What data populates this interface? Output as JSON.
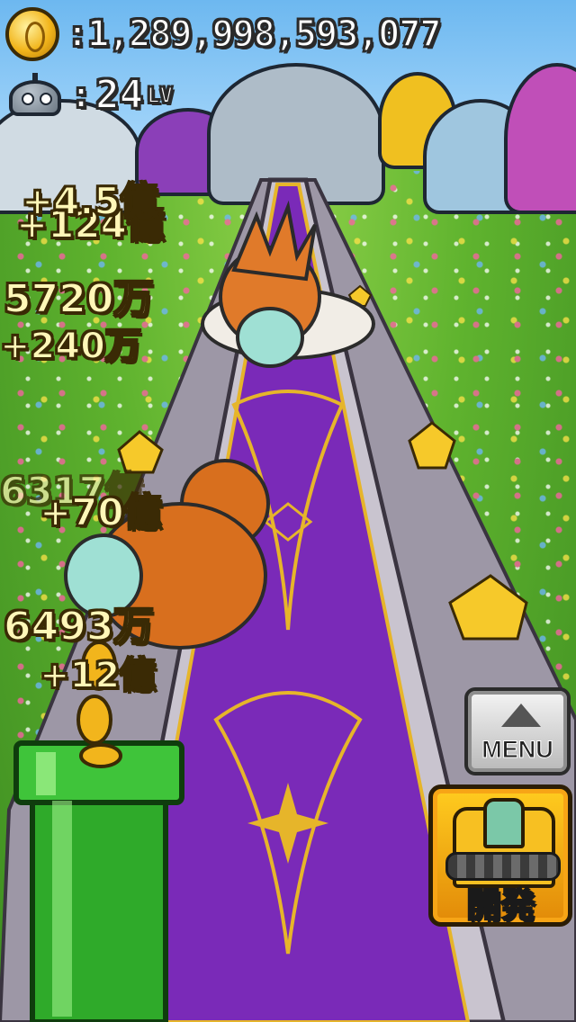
{
  "hud": {
    "coins": ":1,289,998,593,077",
    "level_prefix": ":",
    "level_number": "24",
    "level_suffix": "LV"
  },
  "floating_texts": [
    {
      "id": "f1",
      "text": "+4.5億"
    },
    {
      "id": "f2",
      "text": "+124億"
    },
    {
      "id": "f3",
      "text": "5720万"
    },
    {
      "id": "f4",
      "text": "+240万"
    },
    {
      "id": "f5",
      "text": "6317億"
    },
    {
      "id": "f6",
      "text": "+70億"
    },
    {
      "id": "f7",
      "text": "6493万"
    },
    {
      "id": "f8",
      "text": "+12億"
    }
  ],
  "buttons": {
    "menu": "MENU",
    "develop": "開発"
  },
  "icons": {
    "coin": "coin-icon",
    "robot": "robot-head-icon",
    "menu_arrow": "up-triangle-icon",
    "pipe": "warp-pipe-icon",
    "develop": "drill-machine-icon"
  },
  "colors": {
    "carpet": "#7a2ab8",
    "carpet_trim": "#e6b52a",
    "pipe": "#2faa2a",
    "grass": "#5fb32e"
  }
}
